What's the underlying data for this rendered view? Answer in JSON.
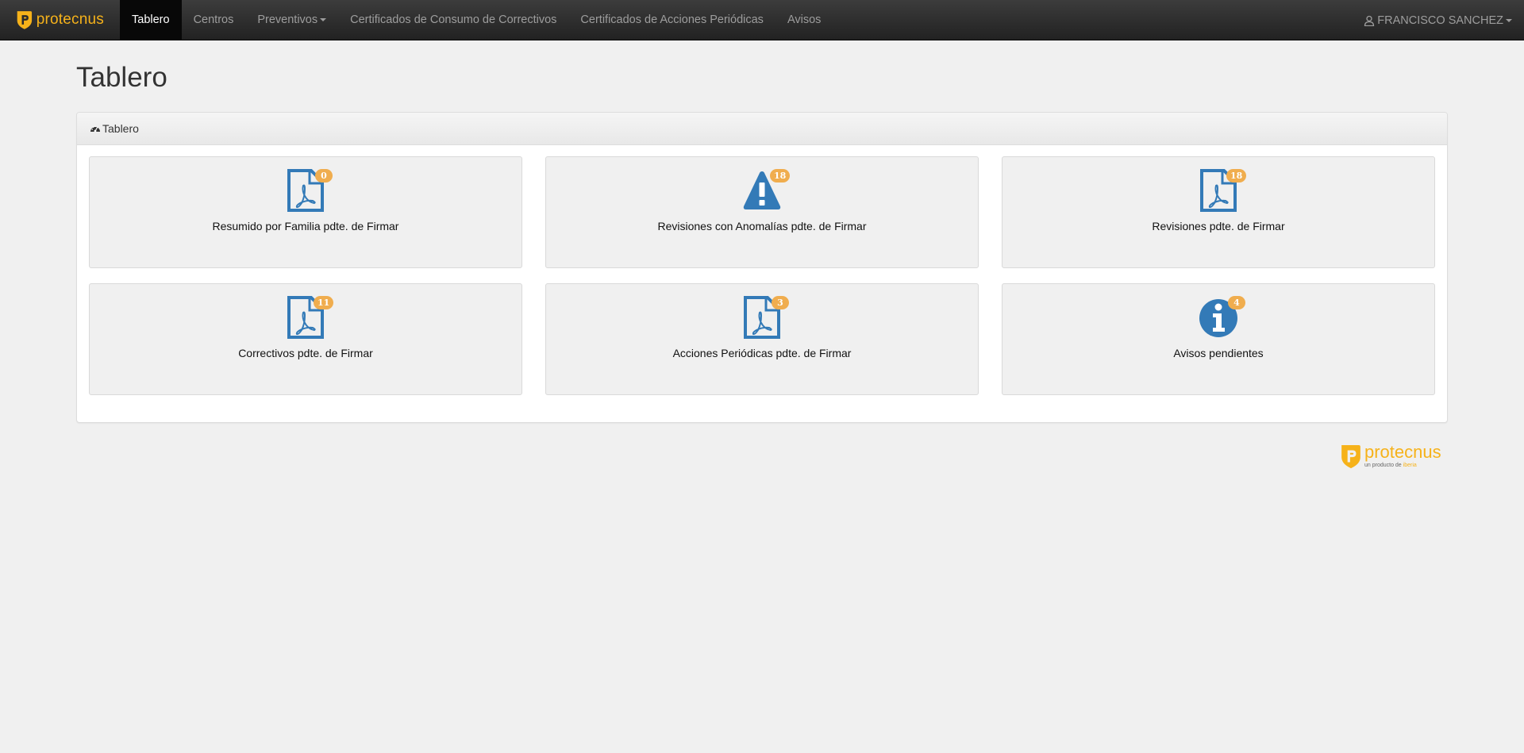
{
  "brand": {
    "name": "protecnus",
    "color": "#f6b21a"
  },
  "nav": {
    "items": [
      {
        "label": "Tablero",
        "active": true
      },
      {
        "label": "Centros"
      },
      {
        "label": "Preventivos",
        "dropdown": true
      },
      {
        "label": "Certificados de Consumo de Correctivos"
      },
      {
        "label": "Certificados de Acciones Periódicas"
      },
      {
        "label": "Avisos"
      }
    ],
    "user": {
      "name": "FRANCISCO SANCHEZ",
      "icon": "user-icon"
    }
  },
  "page": {
    "title": "Tablero"
  },
  "panel": {
    "heading": "Tablero",
    "heading_icon": "dashboard-icon"
  },
  "tiles": [
    {
      "label": "Resumido por Familia pdte. de Firmar",
      "count": "0",
      "icon": "pdf-file-icon"
    },
    {
      "label": "Revisiones con Anomalías pdte. de Firmar",
      "count": "18",
      "icon": "warning-icon"
    },
    {
      "label": "Revisiones pdte. de Firmar",
      "count": "18",
      "icon": "pdf-file-icon"
    },
    {
      "label": "Correctivos pdte. de Firmar",
      "count": "11",
      "icon": "pdf-file-icon"
    },
    {
      "label": "Acciones Periódicas pdte. de Firmar",
      "count": "3",
      "icon": "pdf-file-icon"
    },
    {
      "label": "Avisos pendientes",
      "count": "4",
      "icon": "info-icon"
    }
  ],
  "footer": {
    "name": "protecnus",
    "sub_prefix": "un producto de",
    "sub_brand": "iberia"
  },
  "colors": {
    "icon_blue": "#337ab7",
    "badge": "#f0ad4e",
    "navbar": "#222222"
  }
}
